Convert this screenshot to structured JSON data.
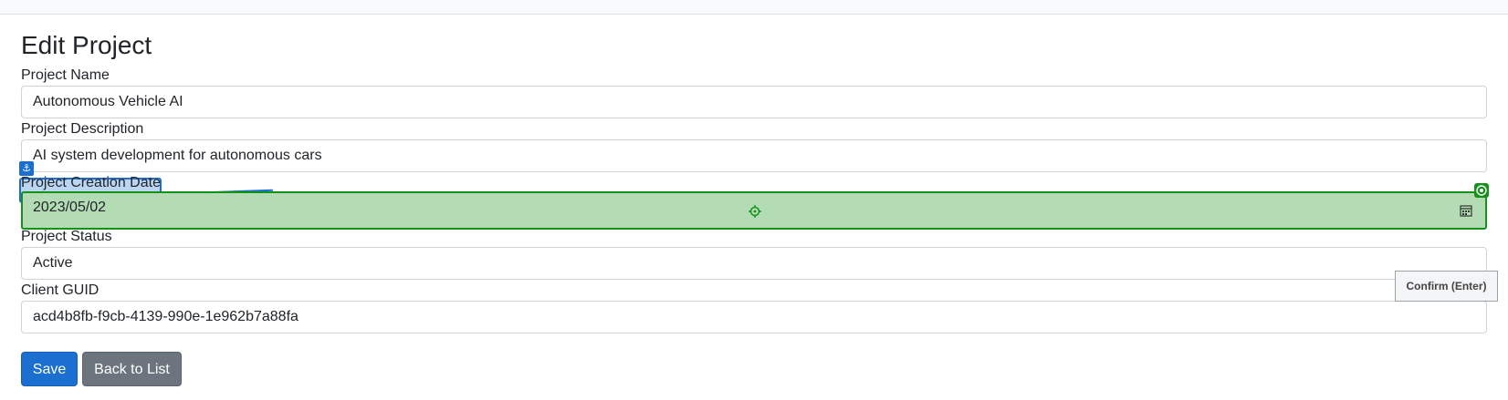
{
  "page": {
    "title": "Edit Project"
  },
  "form": {
    "project_name": {
      "label": "Project Name",
      "value": "Autonomous Vehicle AI"
    },
    "project_description": {
      "label": "Project Description",
      "value": "AI system development for autonomous cars"
    },
    "project_creation_date": {
      "label": "Project Creation Date",
      "value": "2023/05/02"
    },
    "project_status": {
      "label": "Project Status",
      "value": "Active"
    },
    "client_guid": {
      "label": "Client GUID",
      "value": "acd4b8fb-f9cb-4139-990e-1e962b7a88fa"
    }
  },
  "buttons": {
    "save": "Save",
    "back": "Back to List"
  },
  "overlay": {
    "tooltip": "Confirm (Enter)",
    "anchor_icon": "anchor-icon",
    "target_icon": "target-icon",
    "crosshair_icon": "crosshair-icon",
    "calendar_icon": "calendar-icon",
    "highlight_color": "#b3dcb5",
    "label_highlight_color": "#bcd6f2"
  }
}
